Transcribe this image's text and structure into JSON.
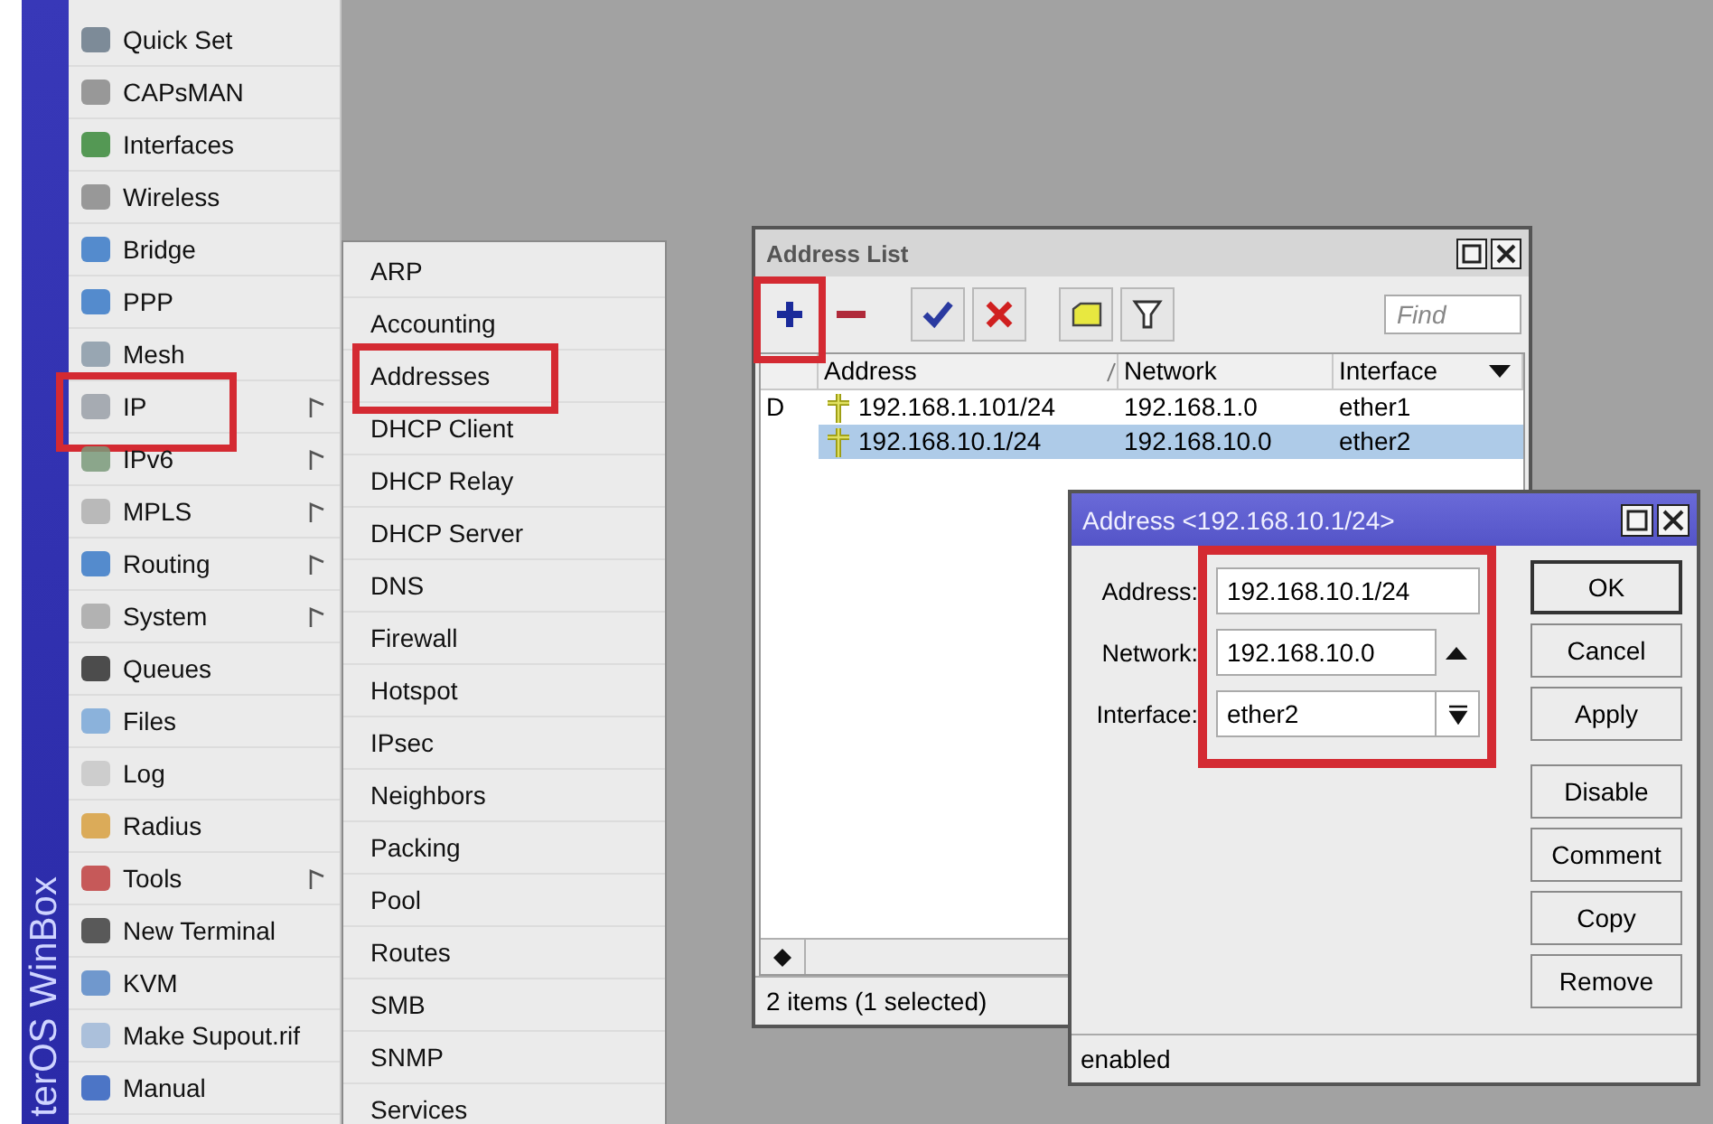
{
  "sidebar": {
    "brand": "terOS WinBox",
    "items": [
      {
        "label": "Quick Set",
        "has_submenu": false,
        "highlighted": false
      },
      {
        "label": "CAPsMAN",
        "has_submenu": false,
        "highlighted": false
      },
      {
        "label": "Interfaces",
        "has_submenu": false,
        "highlighted": false
      },
      {
        "label": "Wireless",
        "has_submenu": false,
        "highlighted": false
      },
      {
        "label": "Bridge",
        "has_submenu": false,
        "highlighted": false
      },
      {
        "label": "PPP",
        "has_submenu": false,
        "highlighted": false
      },
      {
        "label": "Mesh",
        "has_submenu": false,
        "highlighted": false
      },
      {
        "label": "IP",
        "has_submenu": true,
        "highlighted": true
      },
      {
        "label": "IPv6",
        "has_submenu": true,
        "highlighted": false
      },
      {
        "label": "MPLS",
        "has_submenu": true,
        "highlighted": false
      },
      {
        "label": "Routing",
        "has_submenu": true,
        "highlighted": false
      },
      {
        "label": "System",
        "has_submenu": true,
        "highlighted": false
      },
      {
        "label": "Queues",
        "has_submenu": false,
        "highlighted": false
      },
      {
        "label": "Files",
        "has_submenu": false,
        "highlighted": false
      },
      {
        "label": "Log",
        "has_submenu": false,
        "highlighted": false
      },
      {
        "label": "Radius",
        "has_submenu": false,
        "highlighted": false
      },
      {
        "label": "Tools",
        "has_submenu": true,
        "highlighted": false
      },
      {
        "label": "New Terminal",
        "has_submenu": false,
        "highlighted": false
      },
      {
        "label": "KVM",
        "has_submenu": false,
        "highlighted": false
      },
      {
        "label": "Make Supout.rif",
        "has_submenu": false,
        "highlighted": false
      },
      {
        "label": "Manual",
        "has_submenu": false,
        "highlighted": false
      }
    ]
  },
  "submenu": {
    "items": [
      {
        "label": "ARP",
        "highlighted": false
      },
      {
        "label": "Accounting",
        "highlighted": false
      },
      {
        "label": "Addresses",
        "highlighted": true
      },
      {
        "label": "DHCP Client",
        "highlighted": false
      },
      {
        "label": "DHCP Relay",
        "highlighted": false
      },
      {
        "label": "DHCP Server",
        "highlighted": false
      },
      {
        "label": "DNS",
        "highlighted": false
      },
      {
        "label": "Firewall",
        "highlighted": false
      },
      {
        "label": "Hotspot",
        "highlighted": false
      },
      {
        "label": "IPsec",
        "highlighted": false
      },
      {
        "label": "Neighbors",
        "highlighted": false
      },
      {
        "label": "Packing",
        "highlighted": false
      },
      {
        "label": "Pool",
        "highlighted": false
      },
      {
        "label": "Routes",
        "highlighted": false
      },
      {
        "label": "SMB",
        "highlighted": false
      },
      {
        "label": "SNMP",
        "highlighted": false
      },
      {
        "label": "Services",
        "highlighted": false
      }
    ]
  },
  "address_list": {
    "title": "Address List",
    "toolbar": [
      {
        "kind": "add",
        "highlighted": true
      },
      {
        "kind": "remove",
        "highlighted": false
      },
      {
        "kind": "enable",
        "highlighted": false
      },
      {
        "kind": "disable",
        "highlighted": false
      },
      {
        "kind": "comment",
        "highlighted": false
      },
      {
        "kind": "filter",
        "highlighted": false
      }
    ],
    "find": {
      "placeholder": "Find"
    },
    "columns": [
      "Address",
      "Network",
      "Interface"
    ],
    "rows": [
      {
        "flag": "D",
        "address": "192.168.1.101/24",
        "network": "192.168.1.0",
        "interface": "ether1",
        "selected": false
      },
      {
        "flag": "",
        "address": "192.168.10.1/24",
        "network": "192.168.10.0",
        "interface": "ether2",
        "selected": true
      }
    ],
    "status": "2 items (1 selected)"
  },
  "dialog": {
    "title": "Address <192.168.10.1/24>",
    "fields_highlighted": true,
    "fields": [
      {
        "label": "Address:",
        "value": "192.168.10.1/24",
        "kind": "text"
      },
      {
        "label": "Network:",
        "value": "192.168.10.0",
        "kind": "collapse"
      },
      {
        "label": "Interface:",
        "value": "ether2",
        "kind": "dropdown"
      }
    ],
    "button_groups": [
      [
        "OK",
        "Cancel",
        "Apply"
      ],
      [
        "Disable",
        "Comment",
        "Copy",
        "Remove"
      ]
    ],
    "status": "enabled"
  }
}
